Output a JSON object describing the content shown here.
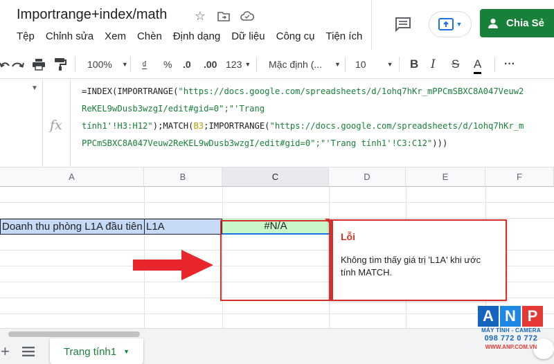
{
  "app": {
    "title": "Importrange+index/math",
    "menu": [
      "Tệp",
      "Chỉnh sửa",
      "Xem",
      "Chèn",
      "Định dạng",
      "Dữ liệu",
      "Công cụ",
      "Tiện ích"
    ],
    "share_label": "Chia Sẻ"
  },
  "toolbar": {
    "zoom": "100%",
    "currency": "₫",
    "percent": "%",
    "dec_decrease": ".0",
    "dec_increase": ".00",
    "more_formats": "123",
    "font": "Mặc định (...",
    "font_size": "10",
    "bold": "B",
    "italic": "I",
    "strike": "S",
    "text_color": "A",
    "more": "···"
  },
  "formula_bar": {
    "fx_label": "fx",
    "line1_a": "=INDEX(IMPORTRANGE(",
    "line1_b": "\"https://docs.google.com/spreadsheets/d/1ohq7hKr_mPPCmSBXC8A047Veuw2",
    "line2": "ReKEL9wDusb3wzgI/edit#gid=0\";\"'Trang",
    "line3_a": "tính1'!H3:H12\"",
    "line3_b": ");MATCH(",
    "line3_ref": "B3",
    "line3_c": ";IMPORTRANGE(",
    "line3_d": "\"https://docs.google.com/spreadsheets/d/1ohq7hKr_m",
    "line4_a": "PPCmSBXC8A047Veuw2ReKEL9wDusb3wzgI/edit#gid=0\";\"'Trang tính1'!C3:C12\"",
    "line4_b": ")))"
  },
  "grid": {
    "columns": [
      "A",
      "B",
      "C",
      "D",
      "E",
      "F"
    ],
    "cell_a": "Doanh thu phòng L1A đầu tiên",
    "cell_b": "L1A",
    "cell_c": "#N/A"
  },
  "error_tooltip": {
    "title": "Lỗi",
    "message": "Không tìm thấy giá trị 'L1A' khi ước tính MATCH."
  },
  "sheets": {
    "active_tab": "Trang tính1"
  },
  "watermark": {
    "letters": [
      "A",
      "N",
      "P"
    ],
    "tagline": "MÁY TÍNH - CAMERA",
    "phone": "098 772 0 772",
    "website": "WWW.ANP.COM.VN"
  },
  "colors": {
    "share_green": "#188038",
    "error_red": "#d32f2f",
    "selection_blue": "#c6d9f7",
    "result_green": "#c9f7c9"
  }
}
